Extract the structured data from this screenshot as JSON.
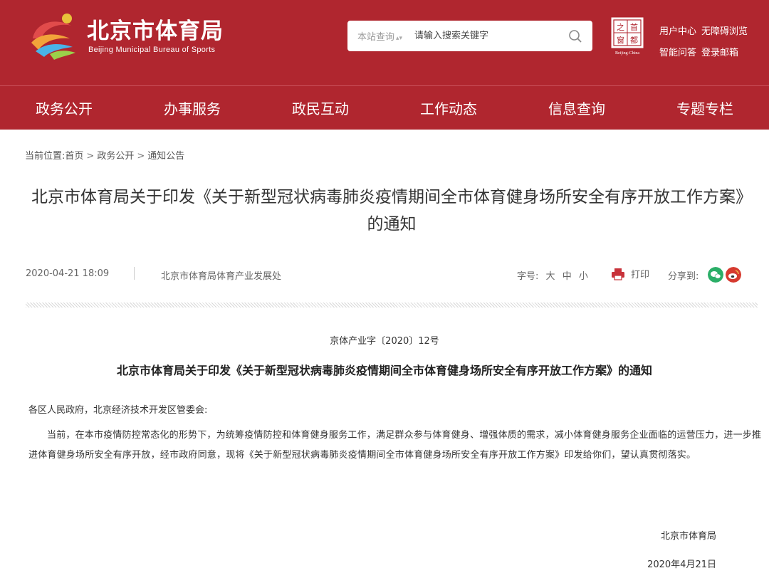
{
  "header": {
    "site_name": "北京市体育局",
    "site_name_en": "Beijing Municipal Bureau of Sports",
    "search": {
      "scope": "本站查询",
      "placeholder": "请输入搜索关键字"
    },
    "capital_logo": {
      "chars": [
        "之",
        "首",
        "窗",
        "都"
      ],
      "caption": "Beijing-China"
    },
    "links": [
      "用户中心",
      "无障碍浏览",
      "智能问答",
      "登录邮箱"
    ]
  },
  "nav": [
    "政务公开",
    "办事服务",
    "政民互动",
    "工作动态",
    "信息查询",
    "专题专栏"
  ],
  "breadcrumb": {
    "prefix": "当前位置:",
    "items": [
      "首页",
      "政务公开",
      "通知公告"
    ],
    "separator": ">"
  },
  "article": {
    "title": "北京市体育局关于印发《关于新型冠状病毒肺炎疫情期间全市体育健身场所安全有序开放工作方案》的通知",
    "date": "2020-04-21 18:09",
    "department": "北京市体育局体育产业发展处",
    "font_size": {
      "label": "字号:",
      "options": [
        "大",
        "中",
        "小"
      ]
    },
    "print_label": "打印",
    "share_label": "分享到:",
    "doc_number": "京体产业字〔2020〕12号",
    "doc_title": "北京市体育局关于印发《关于新型冠状病毒肺炎疫情期间全市体育健身场所安全有序开放工作方案》的通知",
    "salutation": "各区人民政府，北京经济技术开发区管委会:",
    "body": "当前，在本市疫情防控常态化的形势下，为统筹疫情防控和体育健身服务工作，满足群众参与体育健身、增强体质的需求，减小体育健身服务企业面临的运营压力，进一步推进体育健身场所安全有序开放，经市政府同意，现将《关于新型冠状病毒肺炎疫情期间全市体育健身场所安全有序开放工作方案》印发给你们，望认真贯彻落实。",
    "signature": "北京市体育局",
    "sign_date": "2020年4月21日"
  },
  "colors": {
    "brand_red": "#b0262f",
    "wechat_green": "#2aae67",
    "weibo_red": "#d63a2f"
  }
}
